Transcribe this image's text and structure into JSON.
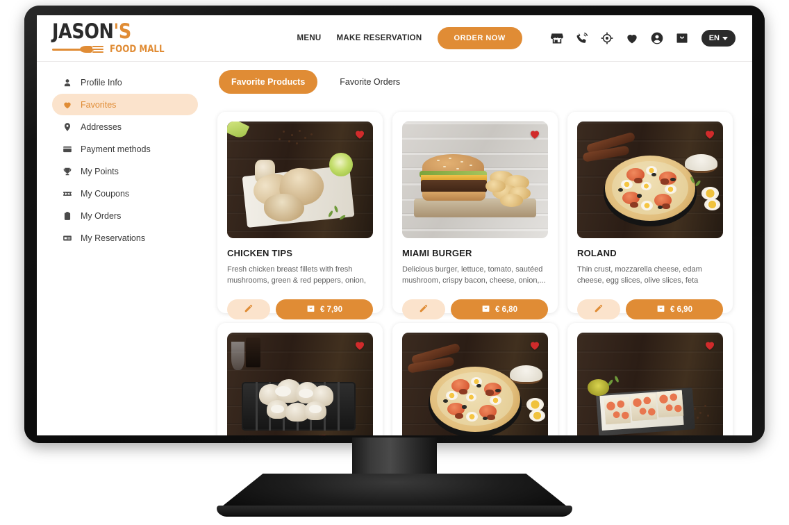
{
  "brand": {
    "name_top": "JASON",
    "apostrophe_s": "'S",
    "name_bottom": "FOOD MALL"
  },
  "header": {
    "nav": [
      {
        "label": "MENU",
        "name": "nav-menu"
      },
      {
        "label": "MAKE RESERVATION",
        "name": "nav-make-reservation"
      }
    ],
    "cta_label": "ORDER NOW",
    "icons": [
      {
        "name": "store-icon",
        "title": "Store"
      },
      {
        "name": "phone-ring-icon",
        "title": "Call"
      },
      {
        "name": "location-target-icon",
        "title": "Find location"
      },
      {
        "name": "heart-icon",
        "title": "Favorites"
      },
      {
        "name": "account-icon",
        "title": "Account"
      },
      {
        "name": "shopping-bag-icon",
        "title": "Cart"
      }
    ],
    "language": "EN"
  },
  "sidebar": {
    "items": [
      {
        "label": "Profile Info",
        "icon": "person-icon",
        "active": false
      },
      {
        "label": "Favorites",
        "icon": "heart-icon",
        "active": true
      },
      {
        "label": "Addresses",
        "icon": "map-pin-icon",
        "active": false
      },
      {
        "label": "Payment methods",
        "icon": "credit-card-icon",
        "active": false
      },
      {
        "label": "My Points",
        "icon": "trophy-icon",
        "active": false
      },
      {
        "label": "My Coupons",
        "icon": "ticket-icon",
        "active": false
      },
      {
        "label": "My Orders",
        "icon": "clipboard-icon",
        "active": false
      },
      {
        "label": "My Reservations",
        "icon": "reservation-icon",
        "active": false
      }
    ]
  },
  "main": {
    "tabs": [
      {
        "label": "Favorite Products",
        "active": true
      },
      {
        "label": "Favorite Orders",
        "active": false
      }
    ],
    "cards": [
      {
        "title": "CHICKEN TIPS",
        "description": "Fresh chicken breast fillets with fresh mushrooms, green & red peppers, onion, crea...",
        "price": "€ 7,90",
        "favorited": true,
        "photo": "chicken-tips"
      },
      {
        "title": "MIAMI BURGER",
        "description": "Delicious burger, lettuce, tomato, sautéed mushroom, crispy bacon, cheese, onion,...",
        "price": "€ 6,80",
        "favorited": true,
        "photo": "miami-burger"
      },
      {
        "title": "ROLAND",
        "description": "Thin crust, mozzarella cheese, edam cheese, egg slices, olive slices, feta cheese, freshly cut...",
        "price": "€ 6,90",
        "favorited": true,
        "photo": "roland-pizza"
      },
      {
        "title": "",
        "description": "",
        "price": "",
        "favorited": true,
        "photo": "grilled-mushrooms"
      },
      {
        "title": "",
        "description": "",
        "price": "",
        "favorited": true,
        "photo": "roland-pizza"
      },
      {
        "title": "",
        "description": "",
        "price": "",
        "favorited": true,
        "photo": "tomato-bruschetta"
      }
    ]
  },
  "colors": {
    "accent": "#e08c35",
    "accent_soft": "#fbe3cc",
    "heart": "#d12b2b",
    "text_dark": "#2b2b2b",
    "bezel": "#0d0d0d"
  }
}
